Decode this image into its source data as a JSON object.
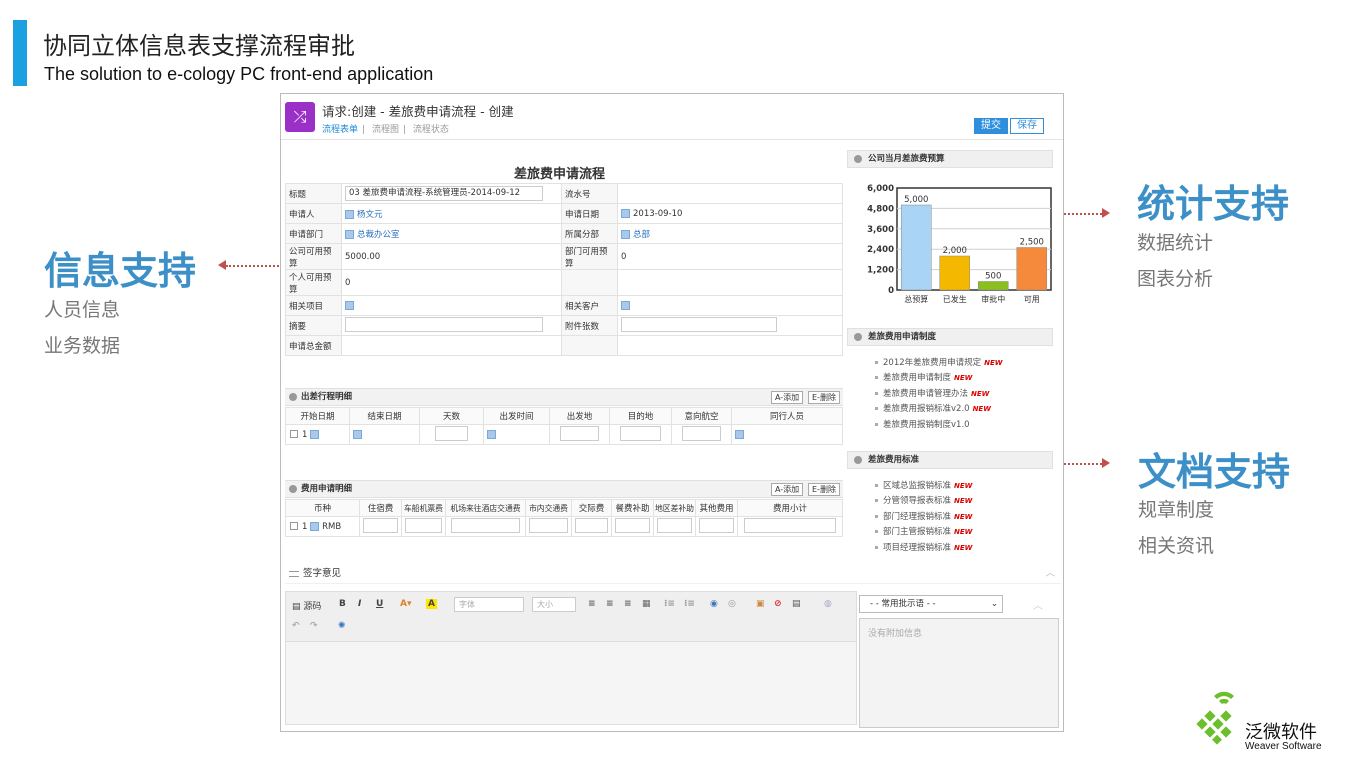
{
  "slide": {
    "title": "协同立体信息表支撑流程审批",
    "subtitle": "The solution to e-cology PC front-end application",
    "left_feature": {
      "title": "信息支持",
      "items": [
        "人员信息",
        "业务数据"
      ]
    },
    "stat_feature": {
      "title": "统计支持",
      "items": [
        "数据统计",
        "图表分析"
      ]
    },
    "doc_feature": {
      "title": "文档支持",
      "items": [
        "规章制度",
        "相关资讯"
      ]
    },
    "logo": {
      "name": "泛微软件",
      "en": "Weaver Software"
    }
  },
  "window": {
    "app_icon": "shuffle-icon",
    "title": "请求:创建 - 差旅费申请流程 - 创建",
    "tabs": [
      "流程表单",
      "流程图",
      "流程状态"
    ],
    "submit_label": "提交",
    "save_label": "保存",
    "form_title": "差旅费申请流程"
  },
  "form": {
    "title_label": "标题",
    "title_value": "03 差旅费申请流程-系统管理员-2014-09-12",
    "serial_label": "流水号",
    "applicant_label": "申请人",
    "applicant_value": "杨文元",
    "apply_date_label": "申请日期",
    "apply_date_value": "2013-09-10",
    "dept_label": "申请部门",
    "dept_value": "总裁办公室",
    "branch_label": "所属分部",
    "branch_value": "总部",
    "company_budget_label": "公司可用预算",
    "company_budget_value": "5000.00",
    "dept_budget_label": "部门可用预算",
    "dept_budget_value": "0",
    "personal_budget_label": "个人可用预算",
    "personal_budget_value": "0",
    "project_label": "相关项目",
    "customer_label": "相关客户",
    "summary_label": "摘要",
    "attach_label": "附件张数",
    "total_label": "申请总金额"
  },
  "trip": {
    "title": "出差行程明细",
    "add_label": "A-添加",
    "delete_label": "E-删除",
    "columns": [
      "开始日期",
      "结束日期",
      "天数",
      "出发时间",
      "出发地",
      "目的地",
      "意向航空",
      "同行人员"
    ],
    "row_index": "1"
  },
  "expense": {
    "title": "费用申请明细",
    "add_label": "A-添加",
    "delete_label": "E-删除",
    "columns": [
      "币种",
      "住宿费",
      "车船机票费",
      "机场来往酒店交通费",
      "市内交通费",
      "交际费",
      "餐费补助",
      "地区差补助",
      "其他费用",
      "费用小计"
    ],
    "row_index": "1",
    "currency": "RMB"
  },
  "sign": {
    "title": "签字意见",
    "source_label": "源码",
    "font_placeholder": "字体",
    "size_placeholder": "大小",
    "phrase_select": "- - 常用批示语 - -",
    "no_info": "没有附加信息"
  },
  "budget_panel": {
    "title": "公司当月差旅费预算"
  },
  "policy_panel": {
    "title": "差旅费用申请制度",
    "items": [
      "2012年差旅费用申请规定",
      "差旅费用申请制度",
      "差旅费用申请管理办法",
      "差旅费用报销标准v2.0",
      "差旅费用报销制度v1.0"
    ],
    "new_flags": [
      true,
      true,
      true,
      true,
      false
    ]
  },
  "standard_panel": {
    "title": "差旅费用标准",
    "items": [
      "区域总监报销标准",
      "分管领导报表标准",
      "部门经理报销标准",
      "部门主管报销标准",
      "项目经理报销标准"
    ],
    "new_flags": [
      true,
      true,
      true,
      true,
      true
    ]
  },
  "new_tag": "NEW",
  "chart_data": {
    "type": "bar",
    "categories": [
      "总预算",
      "已发生",
      "审批中",
      "可用"
    ],
    "values": [
      5000,
      2000,
      500,
      2500
    ],
    "data_labels": [
      "5,000",
      "2,000",
      "500",
      "2,500"
    ],
    "ylim": [
      0,
      6000
    ],
    "yticks": [
      "6,000",
      "4,800",
      "3,600",
      "2,400",
      "1,200",
      "0"
    ],
    "ytick_values": [
      6000,
      4800,
      3600,
      2400,
      1200,
      0
    ],
    "colors": [
      "#a9d4f5",
      "#f5b800",
      "#8bbf1e",
      "#f58a3c"
    ],
    "grid": true
  }
}
